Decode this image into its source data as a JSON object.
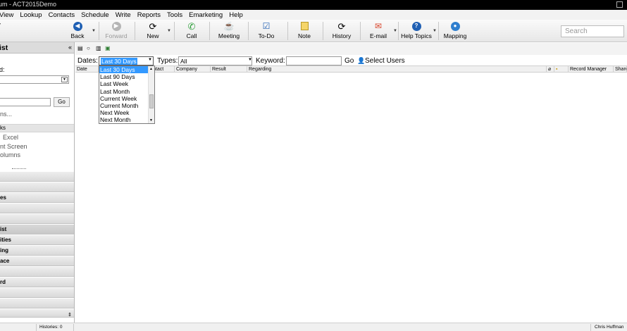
{
  "window": {
    "title": "um - ACT2015Demo"
  },
  "menu": [
    "View",
    "Lookup",
    "Contacts",
    "Schedule",
    "Write",
    "Reports",
    "Tools",
    "Emarketing",
    "Help"
  ],
  "toolbar": {
    "back": "Back",
    "forward": "Forward",
    "new": "New",
    "call": "Call",
    "meeting": "Meeting",
    "todo": "To-Do",
    "note": "Note",
    "history": "History",
    "email": "E-mail",
    "help_topics": "Help Topics",
    "mapping": "Mapping",
    "search_placeholder": "Search"
  },
  "left_pane": {
    "title": "ist",
    "collapse": "«",
    "field_label": "d:",
    "go": "Go",
    "options_link": "ns...",
    "tasks_header": "ks",
    "tasks": [
      "Excel",
      "nt Screen",
      "olumns"
    ],
    "nav": [
      "es",
      "ist",
      "ities",
      "ing",
      "ace",
      "rd"
    ]
  },
  "filters": {
    "dates_label": "Dates:",
    "dates_value": "Last 30 Days",
    "types_label": "Types:",
    "types_value": "All",
    "keyword_label": "Keyword:",
    "keyword_value": "",
    "go": "Go",
    "select_users": "Select Users"
  },
  "grid_columns": [
    "Date",
    "ntact",
    "Company",
    "Result",
    "Regarding",
    "Record Manager",
    "Share"
  ],
  "date_options": [
    "Last 30 Days",
    "Last 90 Days",
    "Last Week",
    "Last Month",
    "Current Week",
    "Current Month",
    "Next Week",
    "Next Month"
  ],
  "status": {
    "histories": "Histories: 0",
    "user": "Chris Huffman"
  },
  "colors": {
    "selection": "#3399ff",
    "back_icon": "#1f5fb3",
    "call_icon": "#2e9e3a",
    "help_icon": "#1f5fb3"
  }
}
